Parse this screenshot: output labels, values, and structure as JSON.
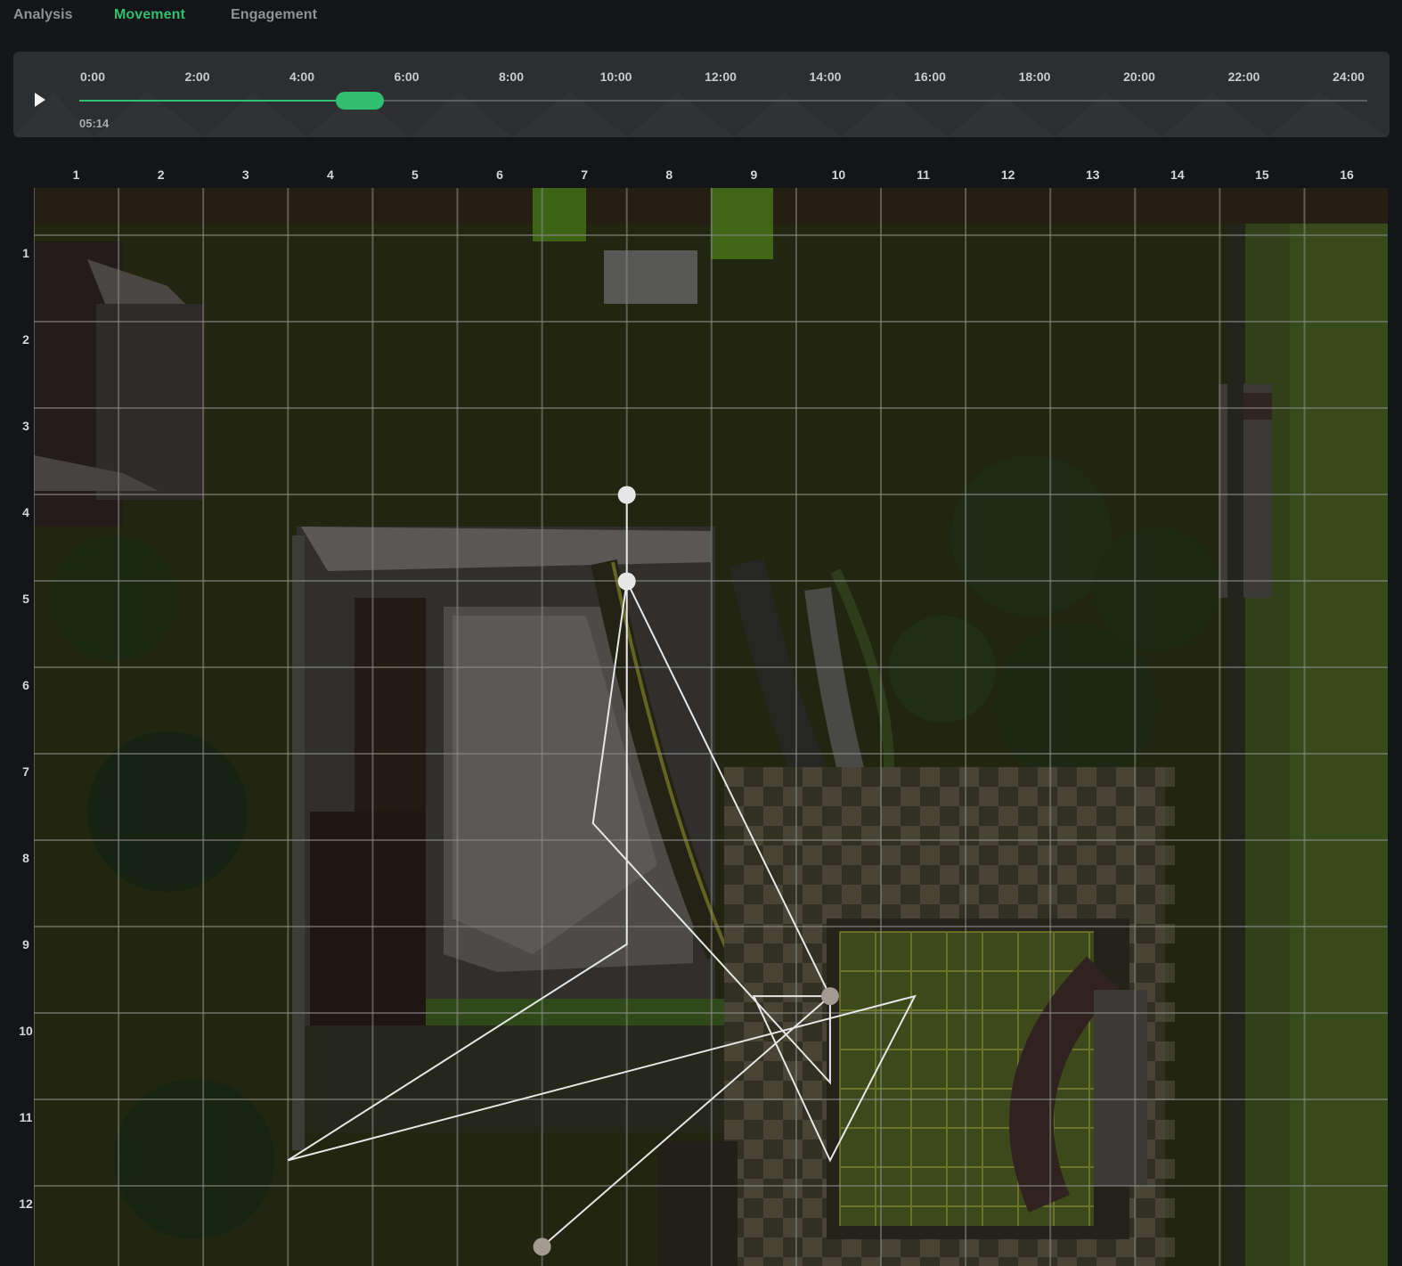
{
  "tabs": [
    {
      "label": "Analysis",
      "active": false
    },
    {
      "label": "Movement",
      "active": true
    },
    {
      "label": "Engagement",
      "active": false
    }
  ],
  "timeline": {
    "ticks": [
      "0:00",
      "2:00",
      "4:00",
      "6:00",
      "8:00",
      "10:00",
      "12:00",
      "14:00",
      "16:00",
      "18:00",
      "20:00",
      "22:00",
      "24:00"
    ],
    "current_time": "05:14",
    "progress_fraction": 0.218,
    "play_icon": "play-icon",
    "accent_color": "#2fbf6f"
  },
  "grid": {
    "columns": [
      "1",
      "2",
      "3",
      "4",
      "5",
      "6",
      "7",
      "8",
      "9",
      "10",
      "11",
      "12",
      "13",
      "14",
      "15",
      "16"
    ],
    "rows": [
      "1",
      "2",
      "3",
      "4",
      "5",
      "6",
      "7",
      "8",
      "9",
      "10",
      "11",
      "12"
    ]
  },
  "movement_path": [
    [
      7.0,
      4.0
    ],
    [
      7.0,
      5.0
    ],
    [
      7.0,
      9.2
    ],
    [
      3.0,
      11.7
    ],
    [
      10.4,
      9.8
    ],
    [
      9.4,
      11.7
    ],
    [
      8.5,
      9.8
    ],
    [
      9.4,
      9.8
    ],
    [
      9.4,
      10.8
    ],
    [
      6.6,
      7.8
    ],
    [
      7.0,
      5.0
    ],
    [
      9.4,
      9.8
    ],
    [
      6.0,
      12.7
    ]
  ],
  "markers": [
    {
      "x": 7.0,
      "y": 4.0,
      "color": "#e6e6e6"
    },
    {
      "x": 7.0,
      "y": 5.0,
      "color": "#e6e6e6"
    },
    {
      "x": 9.4,
      "y": 9.8,
      "color": "#a39a94"
    },
    {
      "x": 6.0,
      "y": 12.7,
      "color": "#a39a94"
    }
  ]
}
